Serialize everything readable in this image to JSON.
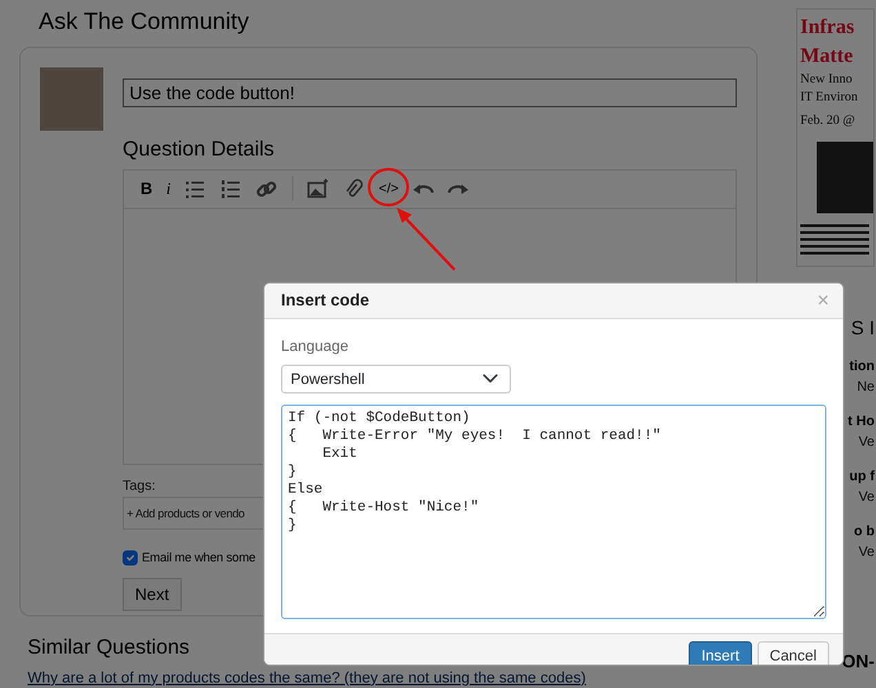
{
  "page": {
    "title": "Ask The Community"
  },
  "question": {
    "value": "Use the code button!",
    "details_label": "Question Details"
  },
  "toolbar": [
    {
      "kind": "bold",
      "glyph": "B"
    },
    {
      "kind": "italic",
      "glyph": "i"
    },
    {
      "kind": "bullets"
    },
    {
      "kind": "numbers"
    },
    {
      "kind": "link"
    },
    {
      "kind": "separator"
    },
    {
      "kind": "image"
    },
    {
      "kind": "attach"
    },
    {
      "kind": "code",
      "glyph": "</>"
    },
    {
      "kind": "undo"
    },
    {
      "kind": "redo"
    }
  ],
  "tags": {
    "label": "Tags:",
    "placeholder": "+ Add products or vendo"
  },
  "email": {
    "label": "Email me when some",
    "checked": true
  },
  "next_button": "Next",
  "similar": {
    "title": "Similar Questions",
    "links": [
      "Why are a lot of my products codes the same? (they are not using the same codes)"
    ]
  },
  "ad": {
    "headline": [
      "Infras",
      "Matte"
    ],
    "lines": [
      "New Inno",
      "IT Environ",
      "Feb. 20 @"
    ]
  },
  "sidebar": {
    "heading": "S I",
    "items": [
      {
        "title": "tion",
        "meta": "Ne"
      },
      {
        "title": "t Ho",
        "meta": "Ve"
      },
      {
        "title": "up f",
        "meta": "Ve"
      },
      {
        "title": "o b",
        "meta": "Ve"
      }
    ],
    "footer": "ON-"
  },
  "modal": {
    "title": "Insert code",
    "close": "×",
    "language_label": "Language",
    "language": "Powershell",
    "code": "If (-not $CodeButton)\n{   Write-Error \"My eyes!  I cannot read!!\"\n    Exit\n}\nElse\n{   Write-Host \"Nice!\"\n}",
    "buttons": [
      {
        "label": "Insert",
        "kind": "primary"
      },
      {
        "label": "Cancel",
        "kind": "secondary"
      }
    ]
  }
}
